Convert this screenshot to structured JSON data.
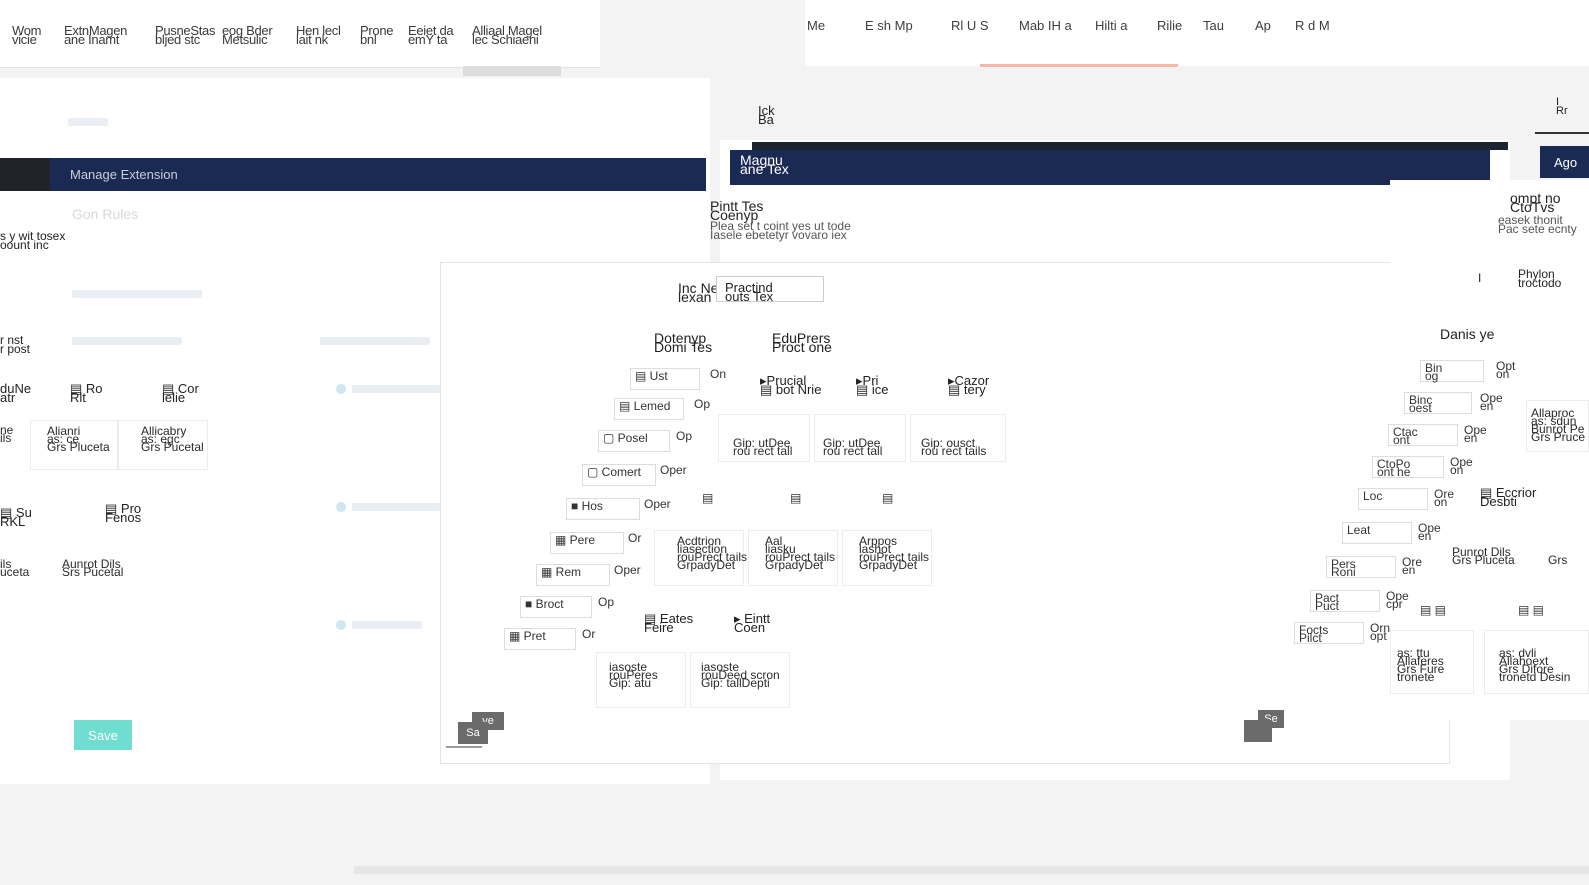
{
  "left_nav": {
    "tabs": [
      {
        "line1": "Wom",
        "line2": "vicie"
      },
      {
        "line1": "ExtnMagen",
        "line2": "ane Inamt"
      },
      {
        "line1": "PusneStas",
        "line2": "bljed stc"
      },
      {
        "line1": "eog Bder",
        "line2": "Metsulic"
      },
      {
        "line1": "Hen lecl",
        "line2": "lait nk"
      },
      {
        "line1": "Prone",
        "line2": "bnl"
      },
      {
        "line1": "Eeiet da",
        "line2": "emY ta"
      },
      {
        "line1": "Alliaal Magel",
        "line2": "lec Schiaeni"
      }
    ]
  },
  "right_nav": {
    "items": [
      "Me",
      "E sh Mp",
      "Rl U S",
      "Mab IH a",
      "Hilti a",
      "Rilie",
      "Tau",
      "Ap",
      "R d M"
    ]
  },
  "left_panel": {
    "header_title": "Manage Extension",
    "header_dark_label": "",
    "section_title": "Gon Rules",
    "sub_lines": [
      "s y wit tosex",
      "oount inc"
    ],
    "sub_title_2": "",
    "label_kpost": "r post",
    "label_kpost2": "r nst",
    "col_labels": [
      "duNe",
      "Ro",
      "Cor"
    ],
    "col_labels_2": [
      "atr",
      "Rlt",
      "lelie"
    ],
    "cards": [
      {
        "a": "ne",
        "b": "ils",
        "c": ""
      },
      {
        "a": "Alianri",
        "b": "as: ce",
        "c": "Grs Pluceta"
      },
      {
        "a": "Allicabry",
        "b": "as: egc",
        "c": "Grs Pucetal"
      }
    ],
    "row2_labels": [
      "Su",
      "Pro"
    ],
    "row2_sub": [
      "RKL",
      "Fenos"
    ],
    "row2_cards": [
      {
        "a": "",
        "b": "ils",
        "c": "uceta"
      },
      {
        "a": "",
        "b": "Aunrot Dils",
        "c": "Srs Pucetal"
      }
    ],
    "save_label": "Save"
  },
  "center_panel": {
    "top_label_1": "Ick",
    "top_label_2": "Ba",
    "header_title_1": "Magnu",
    "header_title_2": "ane Tex",
    "sub_title_1": "Pintt Tes",
    "sub_title_2": "Coenyp",
    "desc_1": "Plea set t coint yes ut tode",
    "desc_2": "Iasele ebetetyr vovaro iex",
    "field_label_1": "Inc Ne",
    "field_label_2": "lexan",
    "field_value": "Practind",
    "field_value_2": "outs Tex",
    "section_a_1": "Dotenyp",
    "section_a_2": "Domi Tes",
    "section_b_1": "EduPrers",
    "section_b_2": "Proct one",
    "options": [
      {
        "label": "On",
        "text": "Ust"
      },
      {
        "label": "Op",
        "text": "Lemed"
      },
      {
        "label": "Op",
        "text": "Posel"
      },
      {
        "label": "Oper",
        "text": "Comert"
      },
      {
        "label": "Oper",
        "text": "Hos"
      },
      {
        "label": "Or",
        "text": "Pere"
      },
      {
        "label": "Oper",
        "text": "Rem"
      },
      {
        "label": "Op",
        "text": "Broct"
      },
      {
        "label": "Or",
        "text": "Pret"
      }
    ],
    "col_heads": [
      {
        "a": "Prucial",
        "b": "bot Nrie"
      },
      {
        "a": "Pri",
        "b": "ice"
      },
      {
        "a": "Cazor",
        "b": "tery"
      }
    ],
    "cards_row1": [
      {
        "a": "Gip: utDee",
        "b": "rou rect tall"
      },
      {
        "a": "Gip: utDee",
        "b": "rou rect tall"
      },
      {
        "a": "Gip: ousct",
        "b": "rou rect tails"
      }
    ],
    "cards_row2": [
      {
        "a": "Acdtrion",
        "b": "liasection",
        "c": "rouPrect tails",
        "d": "GrpadyDet"
      },
      {
        "a": "Aal",
        "b": "liasku",
        "c": "rouPrect tails",
        "d": "GrpadyDet"
      },
      {
        "a": "Arppos",
        "b": "lashot",
        "c": "rouPrect tails",
        "d": "GrpadyDet"
      }
    ],
    "bottom_heads": [
      {
        "a": "Eates",
        "b": "Feire"
      },
      {
        "a": "Eintt",
        "b": "Coen"
      }
    ],
    "bottom_cards": [
      {
        "a": "iasoste",
        "b": "rouPeres",
        "c": "Gip: atu"
      },
      {
        "a": "iasoste",
        "b": "rouDeed scron",
        "c": "Gip: tallDepti"
      }
    ],
    "save_label_a": "ve",
    "save_label_b": "Sa",
    "right_btn_label": "Se"
  },
  "right_panel": {
    "dark_label": "Ago",
    "top_a": "I",
    "top_b": "Rr",
    "head_1": "ompt no",
    "head_2": "CtoTvs",
    "desc_1": "easek thonit",
    "desc_2": "Pac sete ecnty",
    "side_a": "I",
    "side_b": "Phylon",
    "side_c": "troctodo",
    "section": "Danis ye",
    "options": [
      {
        "text": "Bin",
        "sub": "og",
        "op": "Opt",
        "op2": "on"
      },
      {
        "text": "Binc",
        "sub": "oest",
        "op": "Ope",
        "op2": "en"
      },
      {
        "text": "Ctac",
        "sub": "ont",
        "op": "Ope",
        "op2": "en"
      },
      {
        "text": "CtoPo",
        "sub": "ont he",
        "op": "Ope",
        "op2": "on"
      },
      {
        "text": "Loc",
        "sub": "",
        "op": "Ore",
        "op2": "on"
      },
      {
        "text": "Leat",
        "sub": "",
        "op": "Ope",
        "op2": "en"
      },
      {
        "text": "Pers",
        "sub": "Roni",
        "op": "Ore",
        "op2": "en"
      },
      {
        "text": "Pact",
        "sub": "Puct",
        "op": "Ope",
        "op2": "cpr"
      },
      {
        "text": "Focts",
        "sub": "Pilct",
        "op": "Orn",
        "op2": "opt"
      }
    ],
    "cards": [
      {
        "a": "Allaproc",
        "b": "as: sdun",
        "c": "Bunrot Pe",
        "d": "Grs Pruce"
      }
    ],
    "desc_heads": [
      "Eccrior",
      "Desbti"
    ],
    "mini_cards": [
      {
        "a": "Punrot Dils",
        "b": "Grs Pluceta"
      },
      {
        "a": "",
        "b": "Grs"
      }
    ],
    "bottom_cards": [
      {
        "a": "as: ttu",
        "b": "Allaferes",
        "c": "Grs Fure",
        "d": "tronete"
      },
      {
        "a": "as: dvli",
        "b": "Allahoext",
        "c": "Grs Difore",
        "d": "tronetd Desin"
      }
    ]
  }
}
